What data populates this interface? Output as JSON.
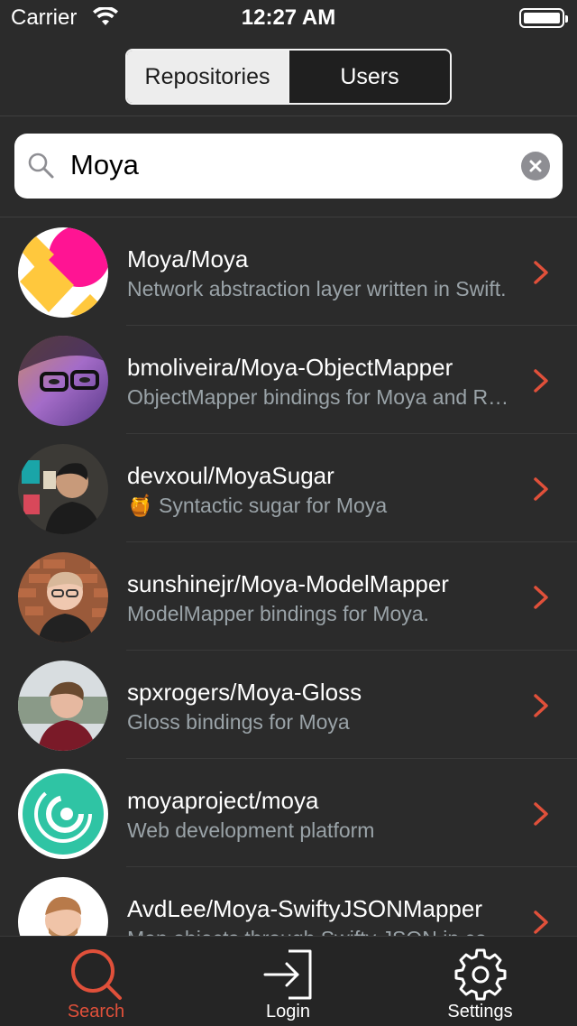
{
  "status": {
    "carrier": "Carrier",
    "time": "12:27 AM"
  },
  "segments": {
    "repositories": "Repositories",
    "users": "Users"
  },
  "search": {
    "value": "Moya"
  },
  "repos": [
    {
      "title": "Moya/Moya",
      "description": "Network abstraction layer written in Swift."
    },
    {
      "title": "bmoliveira/Moya-ObjectMapper",
      "description": "ObjectMapper bindings for Moya and RxSwift"
    },
    {
      "title": "devxoul/MoyaSugar",
      "description": "🍯 Syntactic sugar for Moya"
    },
    {
      "title": "sunshinejr/Moya-ModelMapper",
      "description": "ModelMapper bindings for Moya."
    },
    {
      "title": "spxrogers/Moya-Gloss",
      "description": "Gloss bindings for Moya"
    },
    {
      "title": "moyaproject/moya",
      "description": "Web development platform"
    },
    {
      "title": "AvdLee/Moya-SwiftyJSONMapper",
      "description": "Map objects through Swifty JSON in combination with Moya"
    }
  ],
  "tabs": {
    "search": "Search",
    "login": "Login",
    "settings": "Settings"
  },
  "colors": {
    "accent": "#e0503a",
    "background": "#2b2b2b",
    "secondary_text": "#9aa3a8"
  },
  "icons": [
    "wifi-icon",
    "battery-icon",
    "search-icon",
    "clear-icon",
    "chevron-right-icon",
    "login-icon",
    "gear-icon"
  ]
}
